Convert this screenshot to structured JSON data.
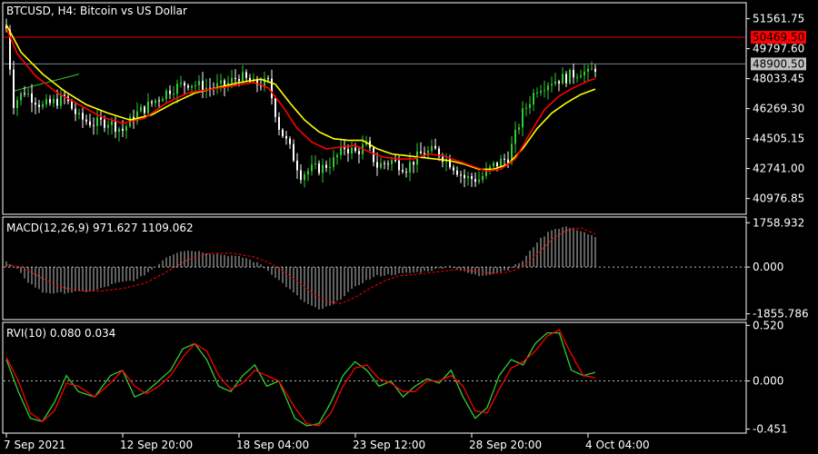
{
  "colors": {
    "background": "#000000",
    "frame": "#ffffff",
    "bull_candle": "#32cd32",
    "bear_candle": "#ffffff",
    "ma_fast": "#ff0000",
    "ma_slow": "#ffff00",
    "high_line": "#ff0000",
    "bid_line": "#778899",
    "trend_line": "#32cd32",
    "macd_hist": "#c0c0c0",
    "macd_signal": "#ff0000",
    "rvi_main": "#32cd32",
    "rvi_signal": "#ff0000",
    "zero_line": "#c0c0c0",
    "text": "#ffffff",
    "tag_text": "#000000"
  },
  "chart_data": [
    {
      "type": "candlestick",
      "panel": "price",
      "title": "BTCUSD, H4:  Bitcoin vs US Dollar",
      "ylim": [
        40100,
        52450
      ],
      "x": {
        "ticks": [
          "7 Sep 2021",
          "12 Sep 20:00",
          "18 Sep 04:00",
          "23 Sep 12:00",
          "28 Sep 20:00",
          "4 Oct 04:00"
        ],
        "tick_bars": [
          0,
          32,
          64,
          96,
          128,
          160
        ],
        "bar_count": 163
      },
      "y_ticks": [
        "51561.75",
        "49797.60",
        "48033.45",
        "46269.30",
        "44505.15",
        "42741.00",
        "40976.85"
      ],
      "y_tick_values": [
        51561.75,
        49797.6,
        48033.45,
        46269.3,
        44505.15,
        42741.0,
        40976.85
      ],
      "price_tags": [
        {
          "label": "50469.50",
          "value": 50469.5,
          "color": "#ff0000",
          "line": "high"
        },
        {
          "label": "48900.50",
          "value": 48900.5,
          "color": "#c0c0c0",
          "line": "bid"
        }
      ],
      "close_path": [
        [
          0,
          50900
        ],
        [
          2,
          46600
        ],
        [
          5,
          47300
        ],
        [
          10,
          46400
        ],
        [
          16,
          46900
        ],
        [
          20,
          45700
        ],
        [
          24,
          45400
        ],
        [
          28,
          45500
        ],
        [
          32,
          45000
        ],
        [
          36,
          46000
        ],
        [
          40,
          46600
        ],
        [
          45,
          47400
        ],
        [
          50,
          47800
        ],
        [
          55,
          47500
        ],
        [
          60,
          47600
        ],
        [
          64,
          48200
        ],
        [
          68,
          47700
        ],
        [
          72,
          47800
        ],
        [
          75,
          45200
        ],
        [
          78,
          43900
        ],
        [
          81,
          42400
        ],
        [
          84,
          42700
        ],
        [
          87,
          42800
        ],
        [
          90,
          43200
        ],
        [
          93,
          44000
        ],
        [
          96,
          43700
        ],
        [
          99,
          44100
        ],
        [
          102,
          42900
        ],
        [
          106,
          43200
        ],
        [
          110,
          42800
        ],
        [
          114,
          43600
        ],
        [
          118,
          43800
        ],
        [
          122,
          43100
        ],
        [
          126,
          42200
        ],
        [
          130,
          42100
        ],
        [
          134,
          42900
        ],
        [
          138,
          43400
        ],
        [
          142,
          46000
        ],
        [
          146,
          47500
        ],
        [
          150,
          47900
        ],
        [
          154,
          48100
        ],
        [
          158,
          48500
        ],
        [
          160,
          48300
        ],
        [
          163,
          48900
        ]
      ],
      "ma_fast_path": [
        [
          0,
          51000
        ],
        [
          3,
          49500
        ],
        [
          8,
          48200
        ],
        [
          14,
          47200
        ],
        [
          20,
          46500
        ],
        [
          26,
          45800
        ],
        [
          32,
          45400
        ],
        [
          38,
          45700
        ],
        [
          44,
          46600
        ],
        [
          50,
          47200
        ],
        [
          56,
          47400
        ],
        [
          62,
          47600
        ],
        [
          68,
          47800
        ],
        [
          72,
          47500
        ],
        [
          76,
          46400
        ],
        [
          80,
          45100
        ],
        [
          84,
          44300
        ],
        [
          88,
          43900
        ],
        [
          92,
          44000
        ],
        [
          96,
          44100
        ],
        [
          100,
          43700
        ],
        [
          104,
          43400
        ],
        [
          108,
          43300
        ],
        [
          112,
          43300
        ],
        [
          116,
          43600
        ],
        [
          120,
          43500
        ],
        [
          124,
          43200
        ],
        [
          128,
          42900
        ],
        [
          132,
          42600
        ],
        [
          136,
          42700
        ],
        [
          140,
          43300
        ],
        [
          144,
          44800
        ],
        [
          148,
          46200
        ],
        [
          152,
          47000
        ],
        [
          156,
          47500
        ],
        [
          160,
          47900
        ],
        [
          163,
          48100
        ]
      ],
      "ma_slow_path": [
        [
          0,
          51200
        ],
        [
          4,
          49600
        ],
        [
          10,
          48300
        ],
        [
          16,
          47300
        ],
        [
          22,
          46500
        ],
        [
          28,
          46000
        ],
        [
          34,
          45600
        ],
        [
          40,
          45900
        ],
        [
          46,
          46600
        ],
        [
          52,
          47200
        ],
        [
          58,
          47500
        ],
        [
          64,
          47800
        ],
        [
          70,
          48000
        ],
        [
          74,
          47700
        ],
        [
          78,
          46600
        ],
        [
          82,
          45600
        ],
        [
          86,
          44900
        ],
        [
          90,
          44500
        ],
        [
          94,
          44400
        ],
        [
          98,
          44400
        ],
        [
          102,
          43900
        ],
        [
          106,
          43600
        ],
        [
          110,
          43500
        ],
        [
          114,
          43400
        ],
        [
          118,
          43300
        ],
        [
          122,
          43200
        ],
        [
          126,
          43000
        ],
        [
          130,
          42700
        ],
        [
          134,
          42700
        ],
        [
          138,
          43000
        ],
        [
          142,
          43900
        ],
        [
          146,
          45100
        ],
        [
          150,
          46000
        ],
        [
          154,
          46600
        ],
        [
          158,
          47100
        ],
        [
          163,
          47500
        ]
      ],
      "trend_line": [
        [
          2,
          47300
        ],
        [
          20,
          48300
        ]
      ]
    },
    {
      "type": "histogram",
      "panel": "macd",
      "title": "MACD(12,26,9) 971.627 1109.062",
      "ylim": [
        -2050,
        1950
      ],
      "y_ticks": [
        "1758.932",
        "0.000",
        "-1855.786"
      ],
      "y_tick_values": [
        1758.932,
        0,
        -1855.786
      ],
      "histogram_path": [
        [
          0,
          200
        ],
        [
          3,
          -100
        ],
        [
          6,
          -600
        ],
        [
          10,
          -1000
        ],
        [
          14,
          -1050
        ],
        [
          18,
          -1000
        ],
        [
          24,
          -950
        ],
        [
          30,
          -650
        ],
        [
          36,
          -500
        ],
        [
          40,
          -100
        ],
        [
          44,
          400
        ],
        [
          48,
          650
        ],
        [
          52,
          650
        ],
        [
          56,
          550
        ],
        [
          62,
          450
        ],
        [
          66,
          350
        ],
        [
          70,
          100
        ],
        [
          74,
          -400
        ],
        [
          78,
          -900
        ],
        [
          82,
          -1400
        ],
        [
          86,
          -1700
        ],
        [
          90,
          -1500
        ],
        [
          94,
          -1000
        ],
        [
          98,
          -600
        ],
        [
          102,
          -350
        ],
        [
          106,
          -300
        ],
        [
          110,
          -250
        ],
        [
          114,
          -200
        ],
        [
          118,
          -100
        ],
        [
          122,
          50
        ],
        [
          126,
          -200
        ],
        [
          130,
          -350
        ],
        [
          134,
          -250
        ],
        [
          138,
          -100
        ],
        [
          142,
          250
        ],
        [
          146,
          1000
        ],
        [
          150,
          1500
        ],
        [
          154,
          1600
        ],
        [
          158,
          1450
        ],
        [
          163,
          1100
        ]
      ],
      "signal_path": [
        [
          0,
          100
        ],
        [
          4,
          0
        ],
        [
          8,
          -300
        ],
        [
          14,
          -750
        ],
        [
          20,
          -950
        ],
        [
          26,
          -950
        ],
        [
          32,
          -850
        ],
        [
          38,
          -650
        ],
        [
          44,
          -200
        ],
        [
          50,
          300
        ],
        [
          56,
          550
        ],
        [
          62,
          550
        ],
        [
          68,
          400
        ],
        [
          72,
          200
        ],
        [
          76,
          -150
        ],
        [
          80,
          -550
        ],
        [
          84,
          -1000
        ],
        [
          88,
          -1350
        ],
        [
          92,
          -1450
        ],
        [
          96,
          -1200
        ],
        [
          100,
          -850
        ],
        [
          104,
          -550
        ],
        [
          108,
          -350
        ],
        [
          112,
          -300
        ],
        [
          118,
          -200
        ],
        [
          124,
          -100
        ],
        [
          128,
          -150
        ],
        [
          134,
          -250
        ],
        [
          138,
          -200
        ],
        [
          142,
          0
        ],
        [
          146,
          500
        ],
        [
          150,
          1100
        ],
        [
          154,
          1450
        ],
        [
          158,
          1550
        ],
        [
          163,
          1250
        ]
      ]
    },
    {
      "type": "line",
      "panel": "rvi",
      "title": "RVI(10) 0.080 0.034",
      "ylim": [
        -0.48,
        0.54
      ],
      "y_ticks": [
        "0.520",
        "0.000",
        "-0.451"
      ],
      "y_tick_values": [
        0.52,
        0,
        -0.451
      ],
      "main_path": [
        [
          0,
          0.2
        ],
        [
          3,
          -0.1
        ],
        [
          6,
          -0.35
        ],
        [
          9,
          -0.38
        ],
        [
          12,
          -0.2
        ],
        [
          15,
          0.05
        ],
        [
          18,
          -0.1
        ],
        [
          22,
          -0.15
        ],
        [
          26,
          0.05
        ],
        [
          29,
          0.1
        ],
        [
          32,
          -0.15
        ],
        [
          35,
          -0.1
        ],
        [
          38,
          0.0
        ],
        [
          41,
          0.1
        ],
        [
          44,
          0.3
        ],
        [
          47,
          0.35
        ],
        [
          50,
          0.2
        ],
        [
          53,
          -0.05
        ],
        [
          56,
          -0.1
        ],
        [
          59,
          0.05
        ],
        [
          62,
          0.15
        ],
        [
          65,
          -0.05
        ],
        [
          68,
          0.0
        ],
        [
          72,
          -0.35
        ],
        [
          75,
          -0.42
        ],
        [
          78,
          -0.4
        ],
        [
          81,
          -0.2
        ],
        [
          84,
          0.05
        ],
        [
          87,
          0.18
        ],
        [
          90,
          0.1
        ],
        [
          93,
          -0.05
        ],
        [
          96,
          0.0
        ],
        [
          99,
          -0.15
        ],
        [
          102,
          -0.05
        ],
        [
          105,
          0.02
        ],
        [
          108,
          -0.02
        ],
        [
          111,
          0.1
        ],
        [
          114,
          -0.15
        ],
        [
          117,
          -0.35
        ],
        [
          120,
          -0.25
        ],
        [
          123,
          0.05
        ],
        [
          126,
          0.2
        ],
        [
          129,
          0.15
        ],
        [
          132,
          0.35
        ],
        [
          135,
          0.45
        ],
        [
          138,
          0.45
        ],
        [
          141,
          0.1
        ],
        [
          144,
          0.05
        ],
        [
          147,
          0.08
        ]
      ],
      "signal_path": [
        [
          0,
          0.22
        ],
        [
          3,
          0.0
        ],
        [
          6,
          -0.3
        ],
        [
          9,
          -0.38
        ],
        [
          12,
          -0.28
        ],
        [
          15,
          -0.02
        ],
        [
          18,
          -0.05
        ],
        [
          22,
          -0.15
        ],
        [
          26,
          -0.02
        ],
        [
          29,
          0.1
        ],
        [
          32,
          -0.05
        ],
        [
          35,
          -0.12
        ],
        [
          38,
          -0.05
        ],
        [
          41,
          0.05
        ],
        [
          44,
          0.22
        ],
        [
          47,
          0.35
        ],
        [
          50,
          0.28
        ],
        [
          53,
          0.05
        ],
        [
          56,
          -0.08
        ],
        [
          59,
          -0.02
        ],
        [
          62,
          0.1
        ],
        [
          65,
          0.05
        ],
        [
          68,
          0.0
        ],
        [
          72,
          -0.25
        ],
        [
          75,
          -0.4
        ],
        [
          78,
          -0.42
        ],
        [
          81,
          -0.3
        ],
        [
          84,
          -0.05
        ],
        [
          87,
          0.12
        ],
        [
          90,
          0.15
        ],
        [
          93,
          0.02
        ],
        [
          96,
          -0.02
        ],
        [
          99,
          -0.1
        ],
        [
          102,
          -0.1
        ],
        [
          105,
          0.0
        ],
        [
          108,
          0.0
        ],
        [
          111,
          0.05
        ],
        [
          114,
          -0.05
        ],
        [
          117,
          -0.28
        ],
        [
          120,
          -0.3
        ],
        [
          123,
          -0.08
        ],
        [
          126,
          0.12
        ],
        [
          129,
          0.18
        ],
        [
          132,
          0.28
        ],
        [
          135,
          0.42
        ],
        [
          138,
          0.48
        ],
        [
          141,
          0.25
        ],
        [
          144,
          0.05
        ],
        [
          147,
          0.03
        ]
      ]
    }
  ]
}
